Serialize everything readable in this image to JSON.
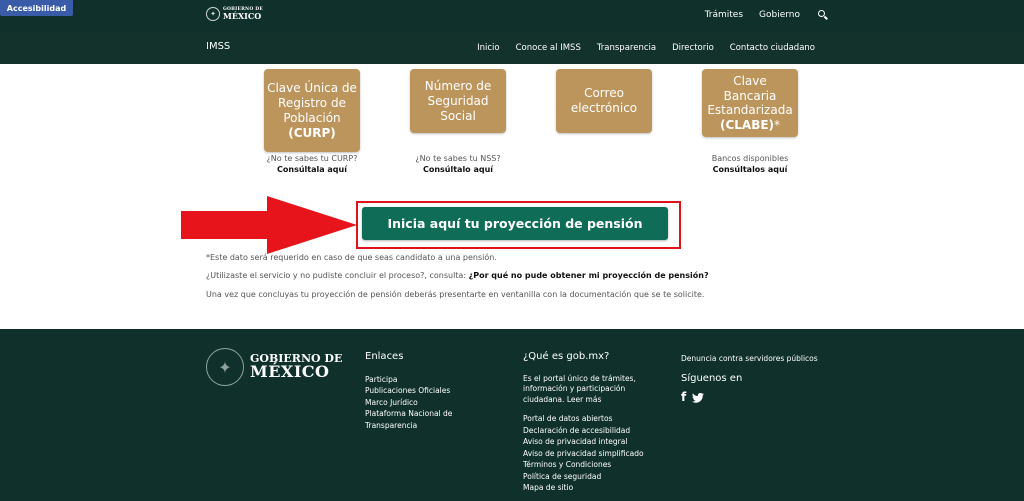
{
  "topbar": {
    "accessibility": "Accesibilidad",
    "logo_line1": "GOBIERNO DE",
    "logo_line2": "MÉXICO",
    "nav": [
      "Trámites",
      "Gobierno"
    ]
  },
  "subnav": {
    "brand": "IMSS",
    "links": [
      "Inicio",
      "Conoce al IMSS",
      "Transparencia",
      "Directorio",
      "Contacto ciudadano"
    ]
  },
  "cards": [
    {
      "text": "Clave Única de Registro de Población",
      "bold": "(CURP)",
      "suffix": "",
      "note": "¿No te sabes tu CURP?",
      "link": "Consúltala aquí"
    },
    {
      "text": "Número de Seguridad Social",
      "bold": "",
      "suffix": "",
      "note": "¿No te sabes tu NSS?",
      "link": "Consúltalo aquí"
    },
    {
      "text": "Correo electrónico",
      "bold": "",
      "suffix": "",
      "note": "",
      "link": ""
    },
    {
      "text": "Clave Bancaria Estandarizada",
      "bold": "(CLABE)",
      "suffix": "*",
      "note": "Bancos disponibles",
      "link": "Consúltalos aquí"
    }
  ],
  "cta": {
    "label": "Inicia aquí tu proyección de pensión"
  },
  "info": {
    "line1": "*Este dato será requerido en caso de que seas candidato a una pensión.",
    "line2_prefix": "¿Utilizaste el servicio y no pudiste concluir el proceso?, consulta: ",
    "line2_link": "¿Por qué no pude obtener mi proyección de pensión?",
    "line3": "Una vez que concluyas tu proyección de pensión deberás presentarte en ventanilla con la documentación que se te solicite."
  },
  "footer": {
    "logo_line1": "GOBIERNO DE",
    "logo_line2": "MÉXICO",
    "enlaces_title": "Enlaces",
    "enlaces": [
      "Participa",
      "Publicaciones Oficiales",
      "Marco Jurídico",
      "Plataforma Nacional de Transparencia"
    ],
    "que_es_title": "¿Qué es gob.mx?",
    "que_es_text": "Es el portal único de trámites, información y participación ciudadana.",
    "leer_mas": "Leer más",
    "portal_links": [
      "Portal de datos abiertos",
      "Declaración de accesibilidad",
      "Aviso de privacidad integral",
      "Aviso de privacidad simplificado",
      "Términos y Condiciones",
      "Política de seguridad",
      "Mapa de sitio"
    ],
    "denuncia": "Denuncia contra servidores públicos",
    "siguenos": "Síguenos en",
    "facebook": "f"
  }
}
